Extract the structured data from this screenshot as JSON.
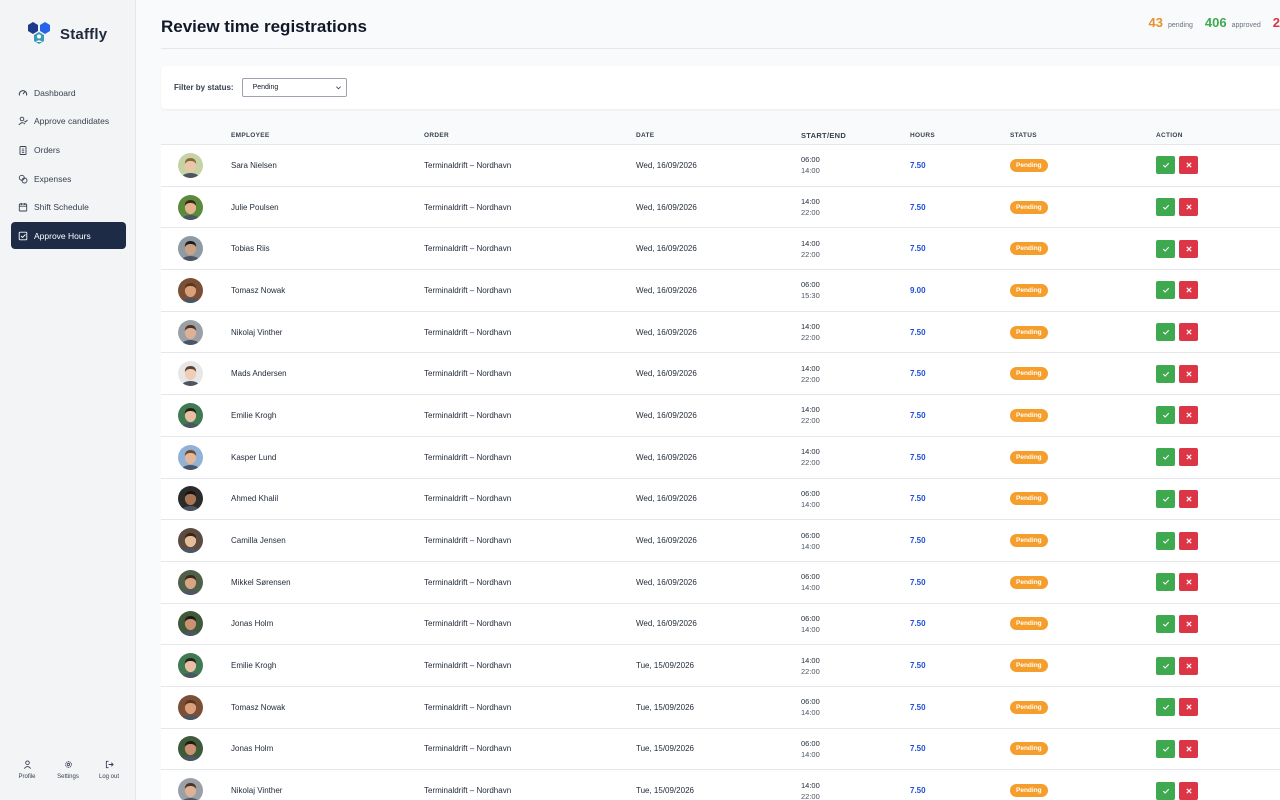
{
  "app": {
    "name": "Staffly"
  },
  "nav": [
    {
      "label": "Dashboard",
      "icon": "gauge-icon",
      "active": false
    },
    {
      "label": "Approve candidates",
      "icon": "user-check-icon",
      "active": false
    },
    {
      "label": "Orders",
      "icon": "clipboard-icon",
      "active": false
    },
    {
      "label": "Expenses",
      "icon": "coins-icon",
      "active": false
    },
    {
      "label": "Shift Schedule",
      "icon": "calendar-icon",
      "active": false
    },
    {
      "label": "Approve Hours",
      "icon": "checkbox-icon",
      "active": true
    }
  ],
  "bottom_nav": {
    "profile": "Profile",
    "settings": "Settings",
    "logout": "Log out"
  },
  "page": {
    "title": "Review time registrations"
  },
  "stats": [
    {
      "value": "43",
      "label": "pending",
      "color": "#e8912d"
    },
    {
      "value": "406",
      "label": "approved",
      "color": "#3fa950"
    },
    {
      "value": "2",
      "label": "",
      "color": "#dc3545"
    }
  ],
  "filter": {
    "label": "Filter by status:",
    "selected": "Pending"
  },
  "table": {
    "headers": {
      "employee": "EMPLOYEE",
      "order": "ORDER",
      "date": "DATE",
      "time": "START/END",
      "hours": "HOURS",
      "status": "STATUS",
      "action": "ACTION"
    },
    "rows": [
      {
        "employee": "Sara Nielsen",
        "order": "Terminaldrift – Nordhavn",
        "date": "Wed, 16/09/2026",
        "start": "06:00",
        "end": "14:00",
        "hours": "7.50",
        "status": "Pending",
        "skin": "#e9c8a8",
        "hair": "#8a6a3a",
        "bg": "#c6d3a5"
      },
      {
        "employee": "Julie Poulsen",
        "order": "Terminaldrift – Nordhavn",
        "date": "Wed, 16/09/2026",
        "start": "14:00",
        "end": "22:00",
        "hours": "7.50",
        "status": "Pending",
        "skin": "#e2b58f",
        "hair": "#3e2a1c",
        "bg": "#5a8a3c"
      },
      {
        "employee": "Tobias Riis",
        "order": "Terminaldrift – Nordhavn",
        "date": "Wed, 16/09/2026",
        "start": "14:00",
        "end": "22:00",
        "hours": "7.50",
        "status": "Pending",
        "skin": "#c9a184",
        "hair": "#1c1c1c",
        "bg": "#8f9aa3"
      },
      {
        "employee": "Tomasz Nowak",
        "order": "Terminaldrift – Nordhavn",
        "date": "Wed, 16/09/2026",
        "start": "06:00",
        "end": "15:30",
        "hours": "9.00",
        "status": "Pending",
        "skin": "#d9a07a",
        "hair": "#5a3620",
        "bg": "#7b4e36"
      },
      {
        "employee": "Nikolaj Vinther",
        "order": "Terminaldrift – Nordhavn",
        "date": "Wed, 16/09/2026",
        "start": "14:00",
        "end": "22:00",
        "hours": "7.50",
        "status": "Pending",
        "skin": "#ddb196",
        "hair": "#4a3526",
        "bg": "#9aa0a6"
      },
      {
        "employee": "Mads Andersen",
        "order": "Terminaldrift – Nordhavn",
        "date": "Wed, 16/09/2026",
        "start": "14:00",
        "end": "22:00",
        "hours": "7.50",
        "status": "Pending",
        "skin": "#f0cdb4",
        "hair": "#5b4230",
        "bg": "#e7e7e7"
      },
      {
        "employee": "Emilie Krogh",
        "order": "Terminaldrift – Nordhavn",
        "date": "Wed, 16/09/2026",
        "start": "14:00",
        "end": "22:00",
        "hours": "7.50",
        "status": "Pending",
        "skin": "#e7c0a3",
        "hair": "#2a1f18",
        "bg": "#3f7a52"
      },
      {
        "employee": "Kasper Lund",
        "order": "Terminaldrift – Nordhavn",
        "date": "Wed, 16/09/2026",
        "start": "14:00",
        "end": "22:00",
        "hours": "7.50",
        "status": "Pending",
        "skin": "#e3b79a",
        "hair": "#6b4a30",
        "bg": "#8fb2d6"
      },
      {
        "employee": "Ahmed Khalil",
        "order": "Terminaldrift – Nordhavn",
        "date": "Wed, 16/09/2026",
        "start": "06:00",
        "end": "14:00",
        "hours": "7.50",
        "status": "Pending",
        "skin": "#a97554",
        "hair": "#151515",
        "bg": "#2b2b2b"
      },
      {
        "employee": "Camilla Jensen",
        "order": "Terminaldrift – Nordhavn",
        "date": "Wed, 16/09/2026",
        "start": "06:00",
        "end": "14:00",
        "hours": "7.50",
        "status": "Pending",
        "skin": "#e6bd9b",
        "hair": "#3b2418",
        "bg": "#5b4b40"
      },
      {
        "employee": "Mikkel Sørensen",
        "order": "Terminaldrift – Nordhavn",
        "date": "Wed, 16/09/2026",
        "start": "06:00",
        "end": "14:00",
        "hours": "7.50",
        "status": "Pending",
        "skin": "#d7a582",
        "hair": "#3a2a1c",
        "bg": "#4f5f48"
      },
      {
        "employee": "Jonas Holm",
        "order": "Terminaldrift – Nordhavn",
        "date": "Wed, 16/09/2026",
        "start": "06:00",
        "end": "14:00",
        "hours": "7.50",
        "status": "Pending",
        "skin": "#c99271",
        "hair": "#1f1a16",
        "bg": "#3e5a3a"
      },
      {
        "employee": "Emilie Krogh",
        "order": "Terminaldrift – Nordhavn",
        "date": "Tue, 15/09/2026",
        "start": "14:00",
        "end": "22:00",
        "hours": "7.50",
        "status": "Pending",
        "skin": "#e7c0a3",
        "hair": "#2a1f18",
        "bg": "#3f7a52"
      },
      {
        "employee": "Tomasz Nowak",
        "order": "Terminaldrift – Nordhavn",
        "date": "Tue, 15/09/2026",
        "start": "06:00",
        "end": "14:00",
        "hours": "7.50",
        "status": "Pending",
        "skin": "#d9a07a",
        "hair": "#5a3620",
        "bg": "#7b4e36"
      },
      {
        "employee": "Jonas Holm",
        "order": "Terminaldrift – Nordhavn",
        "date": "Tue, 15/09/2026",
        "start": "06:00",
        "end": "14:00",
        "hours": "7.50",
        "status": "Pending",
        "skin": "#c99271",
        "hair": "#1f1a16",
        "bg": "#3e5a3a"
      },
      {
        "employee": "Nikolaj Vinther",
        "order": "Terminaldrift – Nordhavn",
        "date": "Tue, 15/09/2026",
        "start": "14:00",
        "end": "22:00",
        "hours": "7.50",
        "status": "Pending",
        "skin": "#ddb196",
        "hair": "#4a3526",
        "bg": "#9aa0a6"
      }
    ]
  },
  "colors": {
    "accent": "#1e2b47",
    "approve": "#3fa950",
    "reject": "#dc3545",
    "pending": "#f59e2b",
    "hours": "#1d4ed8"
  }
}
